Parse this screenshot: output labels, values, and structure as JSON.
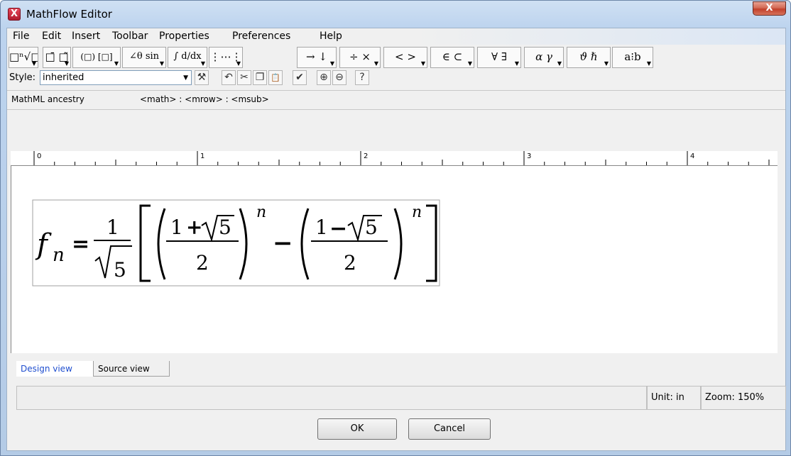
{
  "window": {
    "title": "MathFlow Editor",
    "app_icon": "X",
    "close_label": "X"
  },
  "menu": [
    {
      "label": "File"
    },
    {
      "label": "Edit"
    },
    {
      "label": "Insert"
    },
    {
      "label": "Toolbar"
    },
    {
      "label": "Properties"
    },
    {
      "label": "Preferences"
    },
    {
      "label": "Help"
    }
  ],
  "toolbar": [
    {
      "glyph": "□ⁿ√□",
      "icon": "script-radical-palette-icon"
    },
    {
      "glyph": "□̄ □̃",
      "icon": "accent-palette-icon"
    },
    {
      "glyph": "(□) [□]",
      "icon": "fence-palette-icon"
    },
    {
      "glyph": "∠θ sin",
      "icon": "trig-palette-icon"
    },
    {
      "glyph": "∫ d/dx",
      "icon": "calculus-palette-icon"
    },
    {
      "glyph": "⋮⋯⋮",
      "icon": "matrix-palette-icon"
    },
    {
      "glyph": "→ ↓",
      "icon": "arrow-palette-icon"
    },
    {
      "glyph": "÷ ×",
      "icon": "operator-palette-icon"
    },
    {
      "glyph": "< >",
      "icon": "relation-palette-icon"
    },
    {
      "glyph": "∈ ⊂",
      "icon": "set-palette-icon"
    },
    {
      "glyph": "∀ ∃",
      "icon": "logic-palette-icon"
    },
    {
      "glyph": "α γ",
      "icon": "greek-palette-icon"
    },
    {
      "glyph": "ϑ ℏ",
      "icon": "symbol-palette-icon"
    },
    {
      "glyph": "a⁝b",
      "icon": "spacing-palette-icon"
    }
  ],
  "style": {
    "label": "Style:",
    "value": "inherited"
  },
  "style_tools": [
    {
      "glyph": "⚒",
      "icon": "properties-wrench-icon"
    },
    {
      "glyph": "↶",
      "icon": "undo-icon"
    },
    {
      "glyph": "✂",
      "icon": "cut-icon"
    },
    {
      "glyph": "❐",
      "icon": "copy-icon"
    },
    {
      "glyph": "📋",
      "icon": "paste-icon"
    },
    {
      "glyph": "✔",
      "icon": "check-icon"
    },
    {
      "glyph": "⊕",
      "icon": "zoom-in-icon"
    },
    {
      "glyph": "⊖",
      "icon": "zoom-out-icon"
    },
    {
      "glyph": "?",
      "icon": "help-icon"
    }
  ],
  "ancestry": {
    "label": "MathML ancestry",
    "path": "<math> : <mrow> : <msub>"
  },
  "ruler": {
    "marks": [
      "0",
      "1",
      "2",
      "3",
      "4"
    ]
  },
  "equation": {
    "f": "f",
    "sub_n": "n",
    "equals": "=",
    "one": "1",
    "five": "5",
    "plus": "+",
    "minus": "−",
    "two": "2",
    "exp_n": "n"
  },
  "tabs": [
    {
      "label": "Design view",
      "active": true
    },
    {
      "label": "Source view",
      "active": false
    }
  ],
  "status": {
    "unit": "Unit: in",
    "zoom": "Zoom: 150%"
  },
  "buttons": {
    "ok": "OK",
    "cancel": "Cancel"
  }
}
